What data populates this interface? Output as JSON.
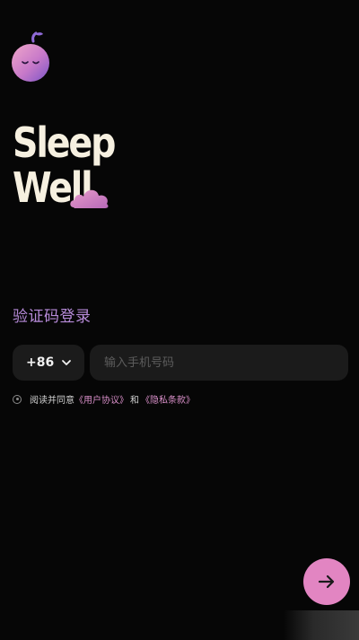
{
  "brand": {
    "line1": "Sleep",
    "line2": "Well"
  },
  "login": {
    "title": "验证码登录"
  },
  "phone": {
    "country_code": "+86",
    "placeholder": "输入手机号码"
  },
  "agreement": {
    "prefix": "阅读并同意",
    "user_agreement": "《用户协议》",
    "joiner": "和",
    "privacy_policy": "《隐私条款》"
  },
  "icons": {
    "mascot": "moon-mascot-icon",
    "cloud": "cloud-icon",
    "chevron": "chevron-down-icon",
    "next": "arrow-right-icon"
  },
  "colors": {
    "background": "#060606",
    "accent_pink": "#e285c2",
    "title_purple": "#b78bd9",
    "brand_cream": "#f6f0e0",
    "field_bg": "#1b1b1b"
  }
}
